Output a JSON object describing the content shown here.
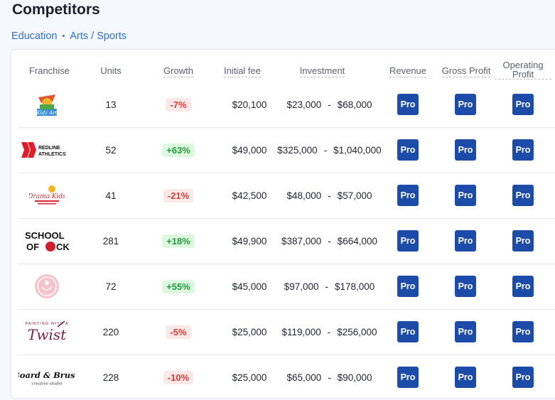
{
  "page": {
    "title": "Competitors"
  },
  "breadcrumb": {
    "category": "Education",
    "subcategory": "Arts / Sports",
    "separator": "•"
  },
  "table": {
    "headers": {
      "franchise": "Franchise",
      "units": "Units",
      "growth": "Growth",
      "initial_fee": "Initial fee",
      "investment": "Investment",
      "revenue": "Revenue",
      "gross_profit": "Gross Profit",
      "operating_profit_1": "Operating",
      "operating_profit_2": "Profit"
    },
    "pro_label": "Pro",
    "range_separator": "-",
    "rows": [
      {
        "logo_text": "Kidz Art",
        "logo_icon": "kidzart-logo-icon",
        "units": "13",
        "growth": "-7%",
        "growth_dir": "neg",
        "initial_fee": "$20,100",
        "inv_min": "$23,000",
        "inv_max": "$68,000"
      },
      {
        "logo_text": "REDLINE ATHLETICS",
        "logo_icon": "redline-athletics-logo-icon",
        "units": "52",
        "growth": "+63%",
        "growth_dir": "pos",
        "initial_fee": "$49,000",
        "inv_min": "$325,000",
        "inv_max": "$1,040,000"
      },
      {
        "logo_text": "Drama Kids",
        "logo_icon": "drama-kids-logo-icon",
        "units": "41",
        "growth": "-21%",
        "growth_dir": "neg",
        "initial_fee": "$42,500",
        "inv_min": "$48,000",
        "inv_max": "$57,000"
      },
      {
        "logo_text": "SCHOOL OF ROCK",
        "logo_icon": "school-of-rock-logo-icon",
        "units": "281",
        "growth": "+18%",
        "growth_dir": "pos",
        "initial_fee": "$49,900",
        "inv_min": "$387,000",
        "inv_max": "$664,000"
      },
      {
        "logo_text": "",
        "logo_icon": "pink-circle-logo-icon",
        "units": "72",
        "growth": "+55%",
        "growth_dir": "pos",
        "initial_fee": "$45,000",
        "inv_min": "$97,000",
        "inv_max": "$178,000"
      },
      {
        "logo_text": "Twist",
        "logo_icon": "painting-with-a-twist-logo-icon",
        "units": "220",
        "growth": "-5%",
        "growth_dir": "neg",
        "initial_fee": "$25,000",
        "inv_min": "$119,000",
        "inv_max": "$256,000"
      },
      {
        "logo_text": "Board & Brush",
        "logo_icon": "board-and-brush-logo-icon",
        "units": "228",
        "growth": "-10%",
        "growth_dir": "neg",
        "initial_fee": "$25,000",
        "inv_min": "$65,000",
        "inv_max": "$90,000"
      }
    ]
  }
}
